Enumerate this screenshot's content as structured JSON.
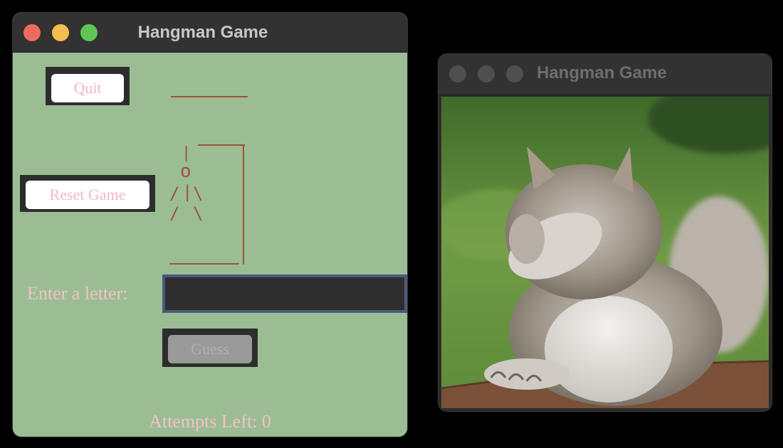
{
  "main_window": {
    "title": "Hangman Game",
    "quit_label": "Quit",
    "reset_label": "Reset Game",
    "entry_prompt": "Enter a letter:",
    "entry_value": "",
    "guess_label": "Guess",
    "attempts_text": "Attempts Left: 0",
    "figure": {
      "rope": "|",
      "head": "o",
      "left_arm": "/",
      "body": "|",
      "right_arm": "\\",
      "left_leg": "/",
      "right_leg": "\\"
    }
  },
  "image_window": {
    "title": "Hangman Game",
    "image_subject": "squirrel-facepalm"
  },
  "colors": {
    "main_bg": "#9bbd94",
    "text_pink": "#f4c0c9",
    "gallows": "#a0523d",
    "entry_border": "#4a5a7a"
  }
}
